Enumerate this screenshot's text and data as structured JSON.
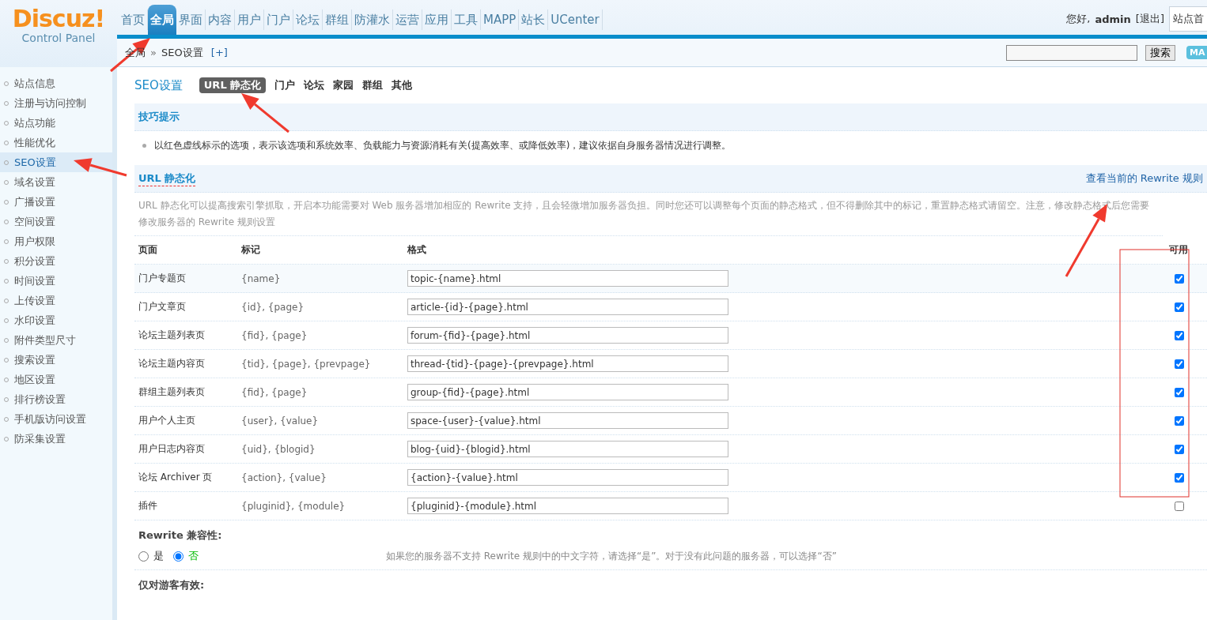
{
  "logo": {
    "title": "Discuz!",
    "subtitle": "Control Panel"
  },
  "nav": [
    {
      "label": "首页",
      "selected": false
    },
    {
      "label": "全局",
      "selected": true
    },
    {
      "label": "界面",
      "selected": false
    },
    {
      "label": "内容",
      "selected": false
    },
    {
      "label": "用户",
      "selected": false
    },
    {
      "label": "门户",
      "selected": false
    },
    {
      "label": "论坛",
      "selected": false
    },
    {
      "label": "群组",
      "selected": false
    },
    {
      "label": "防灌水",
      "selected": false
    },
    {
      "label": "运营",
      "selected": false
    },
    {
      "label": "应用",
      "selected": false
    },
    {
      "label": "工具",
      "selected": false
    },
    {
      "label": "MAPP",
      "selected": false
    },
    {
      "label": "站长",
      "selected": false
    },
    {
      "label": "UCenter",
      "selected": false
    }
  ],
  "user": {
    "greeting": "您好,",
    "name": "admin",
    "logout": "[退出]",
    "site_button": "站点首"
  },
  "breadcrumb": {
    "parent": "全局",
    "separator": "»",
    "current": "SEO设置",
    "add": "[+]"
  },
  "search": {
    "button": "搜索",
    "badge": "MA"
  },
  "sidebar": {
    "items": [
      {
        "label": "站点信息",
        "selected": false
      },
      {
        "label": "注册与访问控制",
        "selected": false
      },
      {
        "label": "站点功能",
        "selected": false
      },
      {
        "label": "性能优化",
        "selected": false
      },
      {
        "label": "SEO设置",
        "selected": true
      },
      {
        "label": "域名设置",
        "selected": false
      },
      {
        "label": "广播设置",
        "selected": false
      },
      {
        "label": "空间设置",
        "selected": false
      },
      {
        "label": "用户权限",
        "selected": false
      },
      {
        "label": "积分设置",
        "selected": false
      },
      {
        "label": "时间设置",
        "selected": false
      },
      {
        "label": "上传设置",
        "selected": false
      },
      {
        "label": "水印设置",
        "selected": false
      },
      {
        "label": "附件类型尺寸",
        "selected": false
      },
      {
        "label": "搜索设置",
        "selected": false
      },
      {
        "label": "地区设置",
        "selected": false
      },
      {
        "label": "排行榜设置",
        "selected": false
      },
      {
        "label": "手机版访问设置",
        "selected": false
      },
      {
        "label": "防采集设置",
        "selected": false
      }
    ]
  },
  "page_title": "SEO设置",
  "subtabs": [
    {
      "label": "URL 静态化",
      "selected": true
    },
    {
      "label": "门户",
      "selected": false
    },
    {
      "label": "论坛",
      "selected": false
    },
    {
      "label": "家园",
      "selected": false
    },
    {
      "label": "群组",
      "selected": false
    },
    {
      "label": "其他",
      "selected": false
    }
  ],
  "tips": {
    "title": "技巧提示",
    "items": [
      "以红色虚线标示的选项，表示该选项和系统效率、负载能力与资源消耗有关(提高效率、或降低效率)，建议依据自身服务器情况进行调整。"
    ]
  },
  "section": {
    "title": "URL 静态化",
    "link": "查看当前的 Rewrite 规则",
    "description": "URL 静态化可以提高搜索引擎抓取，开启本功能需要对 Web 服务器增加相应的 Rewrite 支持，且会轻微增加服务器负担。同时您还可以调整每个页面的静态格式，但不得删除其中的标记，重置静态格式请留空。注意，修改静态格式后您需要修改服务器的 Rewrite 规则设置"
  },
  "table": {
    "columns": [
      "页面",
      "标记",
      "格式",
      "可用"
    ],
    "rows": [
      {
        "page": "门户专题页",
        "marks": "{name}",
        "format": "topic-{name}.html",
        "checked": true
      },
      {
        "page": "门户文章页",
        "marks": "{id}, {page}",
        "format": "article-{id}-{page}.html",
        "checked": true
      },
      {
        "page": "论坛主题列表页",
        "marks": "{fid}, {page}",
        "format": "forum-{fid}-{page}.html",
        "checked": true
      },
      {
        "page": "论坛主题内容页",
        "marks": "{tid}, {page}, {prevpage}",
        "format": "thread-{tid}-{page}-{prevpage}.html",
        "checked": true
      },
      {
        "page": "群组主题列表页",
        "marks": "{fid}, {page}",
        "format": "group-{fid}-{page}.html",
        "checked": true
      },
      {
        "page": "用户个人主页",
        "marks": "{user}, {value}",
        "format": "space-{user}-{value}.html",
        "checked": true
      },
      {
        "page": "用户日志内容页",
        "marks": "{uid}, {blogid}",
        "format": "blog-{uid}-{blogid}.html",
        "checked": true
      },
      {
        "page": "论坛 Archiver 页",
        "marks": "{action}, {value}",
        "format": "{action}-{value}.html",
        "checked": true
      },
      {
        "page": "插件",
        "marks": "{pluginid}, {module}",
        "format": "{pluginid}-{module}.html",
        "checked": false
      }
    ]
  },
  "compat": {
    "title": "Rewrite 兼容性:",
    "options": [
      {
        "label": "是",
        "selected": false
      },
      {
        "label": "否",
        "selected": true
      }
    ],
    "hint": "如果您的服务器不支持 Rewrite 规则中的中文字符，请选择“是”。对于没有此问题的服务器，可以选择“否”"
  },
  "guest_only": {
    "title": "仅对游客有效:"
  }
}
